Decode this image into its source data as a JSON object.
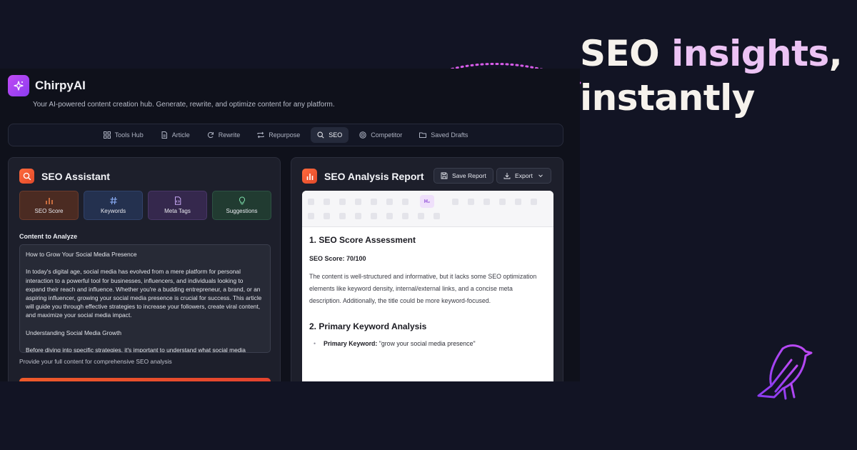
{
  "hero": {
    "line1_a": "SEO ",
    "line1_highlight": "insights",
    "line1_b": ",",
    "line2": "instantly",
    "highlight_color": "#ecc3f4"
  },
  "app": {
    "brand_name": "ChirpyAI",
    "tagline": "Your AI-powered content creation hub. Generate, rewrite, and optimize content for any platform.",
    "nav": [
      {
        "label": "Tools Hub",
        "icon": "grid-icon"
      },
      {
        "label": "Article",
        "icon": "document-icon"
      },
      {
        "label": "Rewrite",
        "icon": "refresh-icon"
      },
      {
        "label": "Repurpose",
        "icon": "repeat-icon"
      },
      {
        "label": "SEO",
        "icon": "search-icon",
        "active": true
      },
      {
        "label": "Competitor",
        "icon": "target-icon"
      },
      {
        "label": "Saved Drafts",
        "icon": "folder-icon"
      }
    ]
  },
  "assistant": {
    "title": "SEO Assistant",
    "tools": [
      {
        "label": "SEO Score",
        "icon": "bar-chart-icon"
      },
      {
        "label": "Keywords",
        "icon": "hash-icon"
      },
      {
        "label": "Meta Tags",
        "icon": "code-file-icon"
      },
      {
        "label": "Suggestions",
        "icon": "lightbulb-icon"
      }
    ],
    "content_label": "Content to Analyze",
    "content_value": "How to Grow Your Social Media Presence\n\nIn today's digital age, social media has evolved from a mere platform for personal interaction to a powerful tool for businesses, influencers, and individuals looking to expand their reach and influence. Whether you're a budding entrepreneur, a brand, or an aspiring influencer, growing your social media presence is crucial for success. This article will guide you through effective strategies to increase your followers, create viral content, and maximize your social media impact.\n\nUnderstanding Social Media Growth\n\nBefore diving into specific strategies, it's important to understand what social media",
    "hint": "Provide your full content for comprehensive SEO analysis"
  },
  "report": {
    "title": "SEO Analysis Report",
    "save_label": "Save Report",
    "export_label": "Export",
    "heading_chip": "H₂",
    "section1_title": "1. SEO Score Assessment",
    "score_text": "SEO Score: 70/100",
    "paragraph": "The content is well-structured and informative, but it lacks some SEO optimization elements like keyword density, internal/external links, and a concise meta description. Additionally, the title could be more keyword-focused.",
    "section2_title": "2. Primary Keyword Analysis",
    "keyword_label": "Primary Keyword:",
    "keyword_value": " \"grow your social media presence\""
  }
}
